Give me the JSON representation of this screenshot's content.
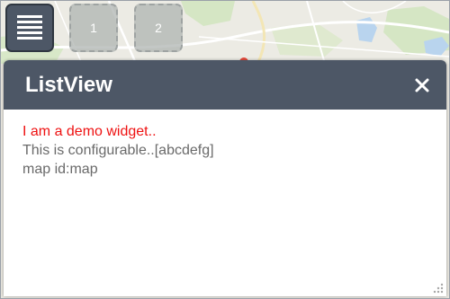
{
  "toolbar": {
    "list_button_icon": "list-icon",
    "slot_one_label": "1",
    "slot_two_label": "2"
  },
  "panel": {
    "title": "ListView",
    "close_icon": "close-icon",
    "lines": [
      "I am a demo widget..",
      "This is configurable..[abcdefg]",
      "map id:map"
    ],
    "resize_icon": "resize-grip-icon"
  },
  "colors": {
    "header_bg": "#4d5766",
    "highlight_text": "#ee1111",
    "body_text": "#6a6a6a"
  }
}
